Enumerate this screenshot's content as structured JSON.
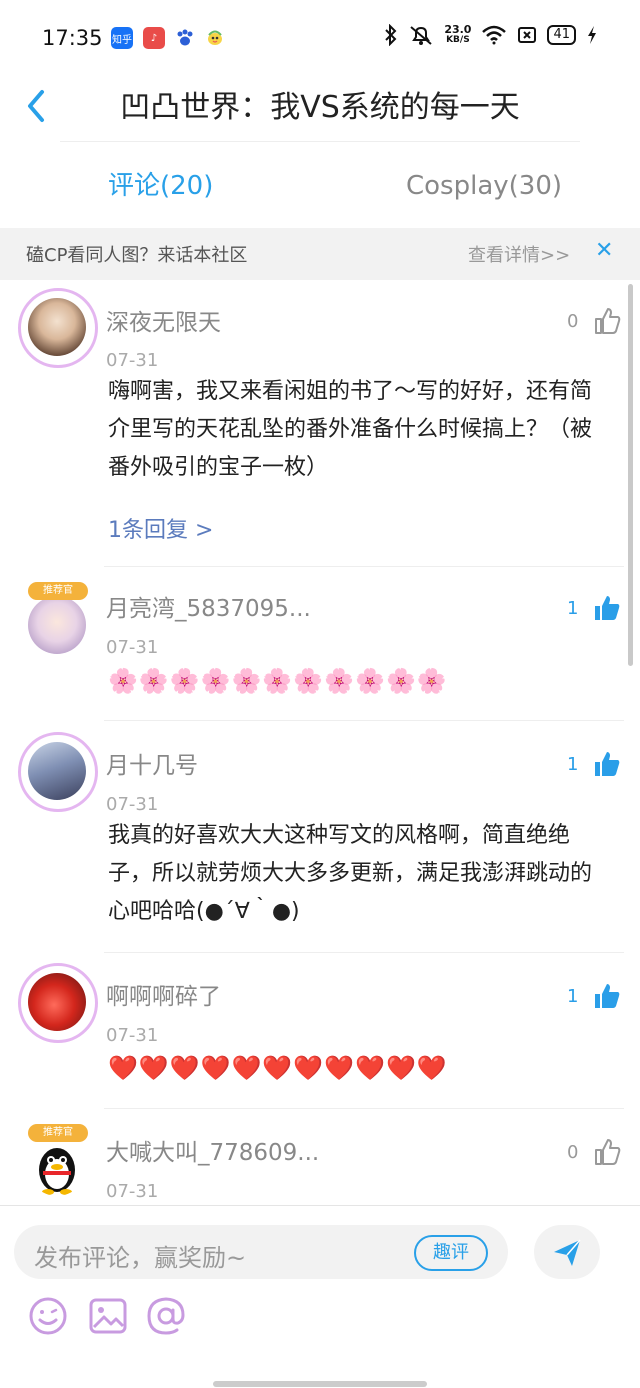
{
  "status_bar": {
    "time": "17:35",
    "apps": [
      {
        "name": "zhihu-icon",
        "text": "知乎",
        "color": "#1772f6"
      },
      {
        "name": "music-icon",
        "text": "♪",
        "color": "#e94c49"
      },
      {
        "name": "baidu-icon",
        "text": "🐾",
        "color": "#ffffff"
      },
      {
        "name": "bird-icon",
        "text": "🐤",
        "color": "#ffffff"
      }
    ],
    "speed_value": "23.0",
    "speed_unit": "KB/S",
    "battery": "41"
  },
  "header": {
    "title": "凹凸世界：我VS系统的每一天"
  },
  "tabs": [
    {
      "label": "评论(20)",
      "active": true
    },
    {
      "label": "Cosplay(30)",
      "active": false
    }
  ],
  "banner": {
    "text": "磕CP看同人图？来话本社区",
    "link": "查看详情>>",
    "close": "✕"
  },
  "comments": [
    {
      "name": "深夜无限天",
      "date": "07-31",
      "text": "嗨啊害，我又来看闲姐的书了～写的好好，还有简介里写的天花乱坠的番外准备什么时候搞上？（被番外吸引的宝子一枚）",
      "likes": "0",
      "liked": false,
      "replies": "1条回复 >",
      "badge": ""
    },
    {
      "name": "月亮湾_5837095...",
      "date": "07-31",
      "text": "🌸🌸🌸🌸🌸🌸🌸🌸🌸🌸🌸",
      "likes": "1",
      "liked": true,
      "replies": "",
      "badge": "推荐官"
    },
    {
      "name": "月十几号",
      "date": "07-31",
      "text": "我真的好喜欢大大这种写文的风格啊，简直绝绝子，所以就劳烦大大多多更新，满足我澎湃跳动的心吧哈哈(●´∀｀●)",
      "likes": "1",
      "liked": true,
      "replies": "",
      "badge": ""
    },
    {
      "name": "啊啊啊碎了",
      "date": "07-31",
      "text": "❤️❤️❤️❤️❤️❤️❤️❤️❤️❤️❤️",
      "likes": "1",
      "liked": true,
      "replies": "",
      "badge": ""
    },
    {
      "name": "大喊大叫_778609...",
      "date": "07-31",
      "text": "",
      "likes": "0",
      "liked": false,
      "replies": "",
      "badge": "推荐官"
    }
  ],
  "input": {
    "placeholder": "发布评论，赢奖励~",
    "quping": "趣评"
  },
  "colors": {
    "accent": "#29a0e8",
    "like_active": "#2a9ee8",
    "like_inactive": "#999999"
  }
}
